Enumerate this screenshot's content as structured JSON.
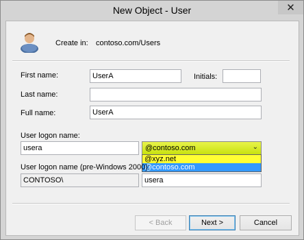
{
  "window": {
    "title": "New Object - User",
    "close_glyph": "✕"
  },
  "header": {
    "create_in_label": "Create in:",
    "create_in_value": "contoso.com/Users",
    "icon": "user-icon"
  },
  "form": {
    "first_name_label": "First name:",
    "first_name_value": "UserA",
    "initials_label": "Initials:",
    "initials_value": "",
    "last_name_label": "Last name:",
    "last_name_value": "",
    "full_name_label": "Full name:",
    "full_name_value": "UserA",
    "logon_label": "User logon name:",
    "logon_value": "usera",
    "upn_suffix_selected": "@contoso.com",
    "upn_suffix_options": [
      "@xyz.net",
      "@contoso.com"
    ],
    "pre2000_label": "User logon name (pre-Windows 2000):",
    "pre2000_domain": "CONTOSO\\",
    "pre2000_value": "usera"
  },
  "buttons": {
    "back": "< Back",
    "next": "Next >",
    "cancel": "Cancel"
  },
  "colors": {
    "combo_highlight": "#d4ea1c",
    "option_hover": "#ffff33",
    "option_selected": "#3399ff"
  }
}
